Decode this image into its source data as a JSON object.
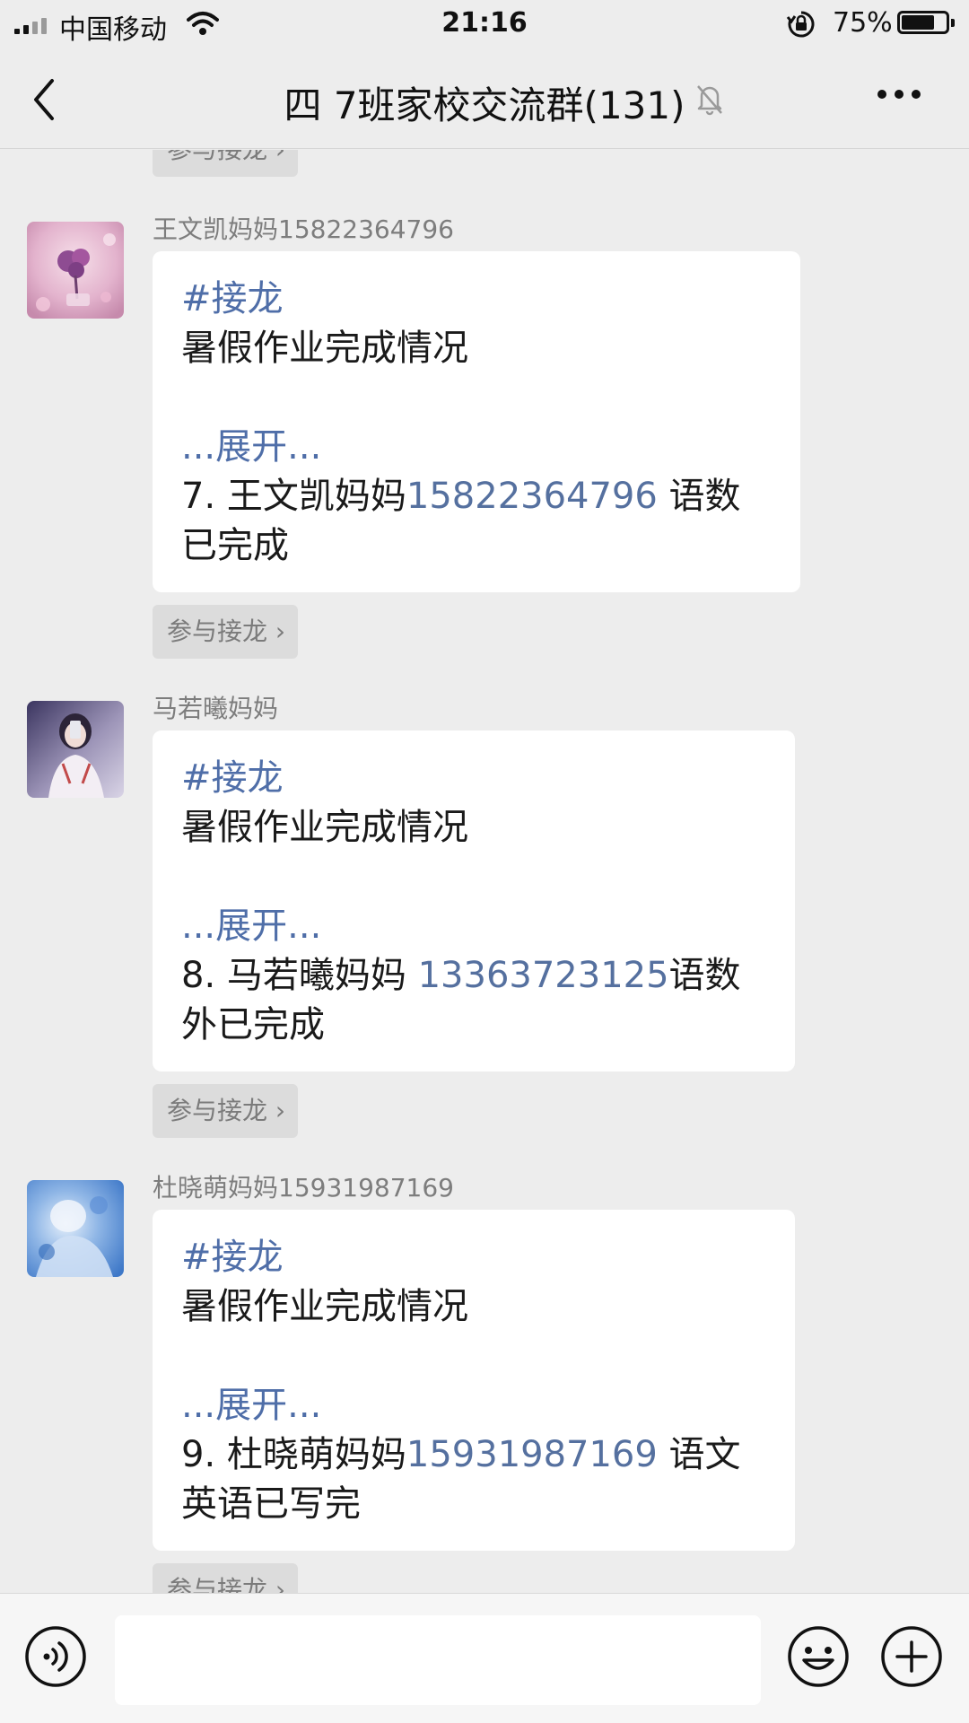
{
  "status_bar": {
    "carrier": "中国移动",
    "time": "21:16",
    "battery_percent": "75%",
    "battery_level": 0.75,
    "icons": [
      "signal-icon",
      "wifi-icon",
      "rotation-lock-icon",
      "battery-icon"
    ]
  },
  "nav": {
    "title": "四 7班家校交流群(131)",
    "icons": [
      "back-arrow-icon",
      "mute-bell-icon",
      "more-dots-icon"
    ]
  },
  "relay_button_label": "参与接龙 ›",
  "messages": [
    {
      "sender": "王文凯妈妈15822364796",
      "tag": "#接龙",
      "subject": "暑假作业完成情况",
      "expand": "...展开...",
      "entry_prefix": "7. 王文凯妈妈",
      "entry_phone": "15822364796",
      "entry_suffix": " 语数",
      "entry_line2": "已完成"
    },
    {
      "sender": "马若曦妈妈",
      "tag": "#接龙",
      "subject": "暑假作业完成情况",
      "expand": "...展开...",
      "entry_prefix": "8. 马若曦妈妈 ",
      "entry_phone": "13363723125",
      "entry_suffix": "语数",
      "entry_line2": "外已完成"
    },
    {
      "sender": "杜晓萌妈妈15931987169",
      "tag": "#接龙",
      "subject": "暑假作业完成情况",
      "expand": "...展开...",
      "entry_prefix": "9. 杜晓萌妈妈",
      "entry_phone": "15931987169",
      "entry_suffix": " 语文",
      "entry_line2": "英语已写完"
    }
  ],
  "input_bar": {
    "icons": [
      "voice-icon",
      "emoji-icon",
      "plus-icon"
    ]
  },
  "colors": {
    "background": "#ededed",
    "bubble": "#ffffff",
    "link_blue": "#4f6ea8",
    "pill": "#dcdcdc"
  }
}
